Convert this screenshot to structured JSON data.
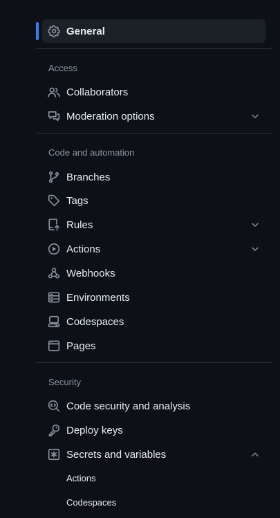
{
  "nav": {
    "general": {
      "label": "General",
      "icon": "gear-icon"
    },
    "sections": [
      {
        "heading": "Access",
        "items": [
          {
            "label": "Collaborators",
            "icon": "people-icon"
          },
          {
            "label": "Moderation options",
            "icon": "comment-discussion-icon",
            "expandable": true,
            "expanded": false
          }
        ]
      },
      {
        "heading": "Code and automation",
        "items": [
          {
            "label": "Branches",
            "icon": "git-branch-icon"
          },
          {
            "label": "Tags",
            "icon": "tag-icon"
          },
          {
            "label": "Rules",
            "icon": "repo-push-icon",
            "expandable": true,
            "expanded": false
          },
          {
            "label": "Actions",
            "icon": "play-icon",
            "expandable": true,
            "expanded": false
          },
          {
            "label": "Webhooks",
            "icon": "webhook-icon"
          },
          {
            "label": "Environments",
            "icon": "server-icon"
          },
          {
            "label": "Codespaces",
            "icon": "codespaces-icon"
          },
          {
            "label": "Pages",
            "icon": "browser-icon"
          }
        ]
      },
      {
        "heading": "Security",
        "items": [
          {
            "label": "Code security and analysis",
            "icon": "codescan-icon"
          },
          {
            "label": "Deploy keys",
            "icon": "key-icon"
          },
          {
            "label": "Secrets and variables",
            "icon": "asterisk-icon",
            "expandable": true,
            "expanded": true,
            "children": [
              {
                "label": "Actions"
              },
              {
                "label": "Codespaces"
              }
            ]
          }
        ]
      }
    ]
  },
  "colors": {
    "background": "#0d1117",
    "selected_bg": "#1c2128",
    "accent": "#2f81f7",
    "text": "#e6edf3",
    "muted": "#8d96a0",
    "divider": "#30363d"
  }
}
